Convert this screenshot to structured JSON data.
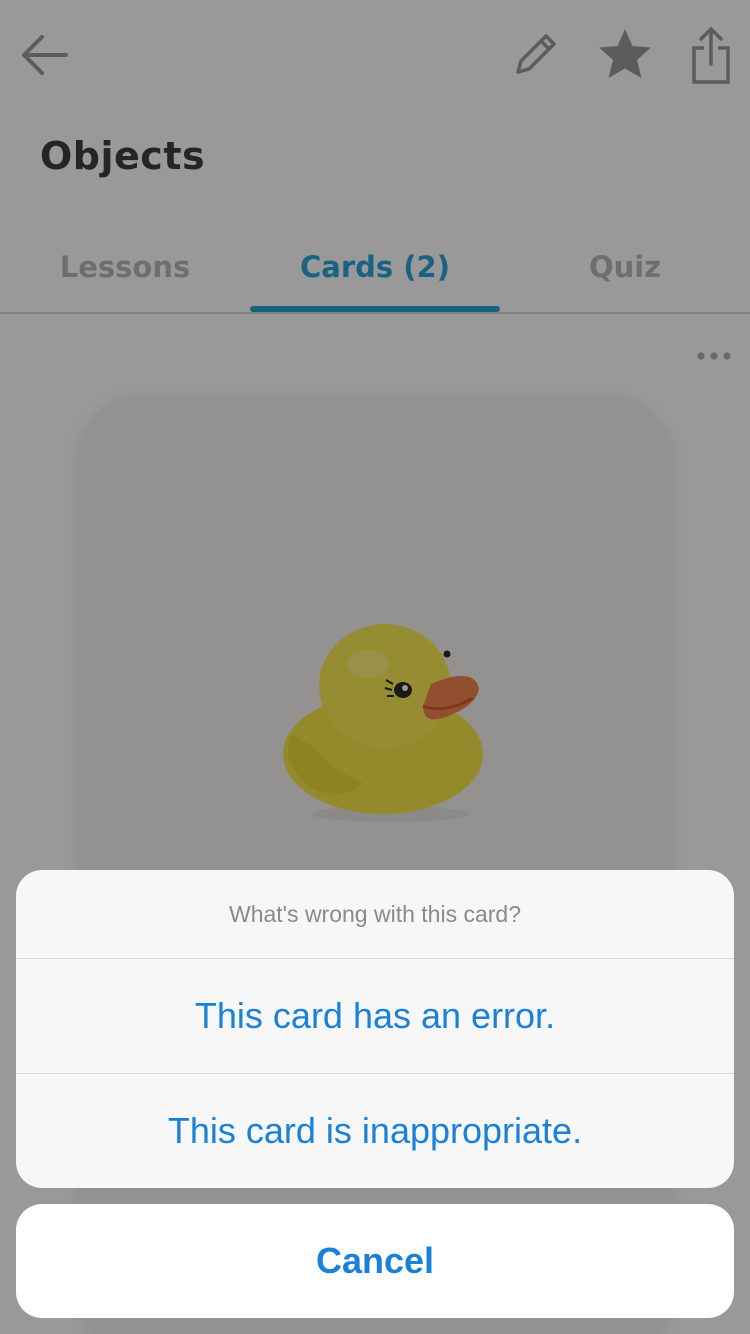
{
  "header": {
    "title": "Objects",
    "icons": [
      "back-arrow-icon",
      "pencil-icon",
      "star-icon",
      "share-icon"
    ]
  },
  "tabs": [
    {
      "label": "Lessons",
      "active": false
    },
    {
      "label": "Cards (2)",
      "active": true
    },
    {
      "label": "Quiz",
      "active": false
    }
  ],
  "card": {
    "image": "rubber-duck"
  },
  "colors": {
    "accent": "#2aa3d8",
    "ios_blue": "#1a80d8",
    "title_text": "#3b3f45",
    "inactive_tab": "#b8b8b8"
  },
  "action_sheet": {
    "title": "What's wrong with this card?",
    "actions": [
      {
        "label": "This card has an error."
      },
      {
        "label": "This card is inappropriate."
      }
    ],
    "cancel_label": "Cancel"
  }
}
